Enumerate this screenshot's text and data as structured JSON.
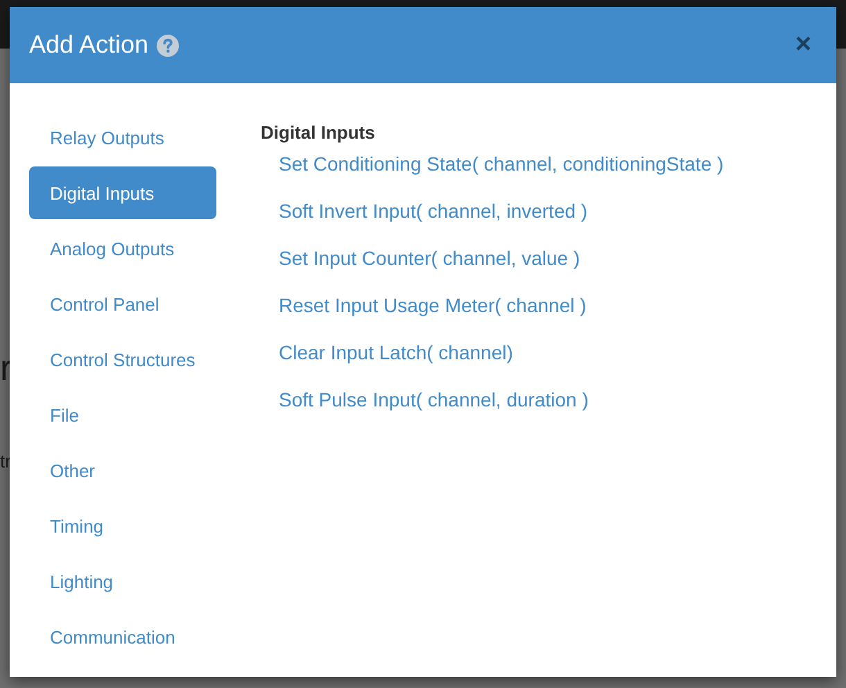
{
  "backdrop": {
    "fragments": [
      {
        "text": "r",
        "kind": "heading"
      },
      {
        "text": "tr",
        "kind": "body"
      }
    ]
  },
  "dialog": {
    "title": "Add Action",
    "close": "×"
  },
  "categories": [
    {
      "label": "Relay Outputs",
      "selected": false
    },
    {
      "label": "Digital Inputs",
      "selected": true
    },
    {
      "label": "Analog Outputs",
      "selected": false
    },
    {
      "label": "Control Panel",
      "selected": false
    },
    {
      "label": "Control Structures",
      "selected": false
    },
    {
      "label": "File",
      "selected": false
    },
    {
      "label": "Other",
      "selected": false
    },
    {
      "label": "Timing",
      "selected": false
    },
    {
      "label": "Lighting",
      "selected": false
    },
    {
      "label": "Communication",
      "selected": false
    }
  ],
  "section": {
    "heading": "Digital Inputs",
    "actions": [
      "Set Conditioning State( channel, conditioningState )",
      "Soft Invert Input( channel, inverted )",
      "Set Input Counter( channel, value )",
      "Reset Input Usage Meter( channel )",
      "Clear Input Latch( channel)",
      "Soft Pulse Input( channel, duration )"
    ]
  }
}
